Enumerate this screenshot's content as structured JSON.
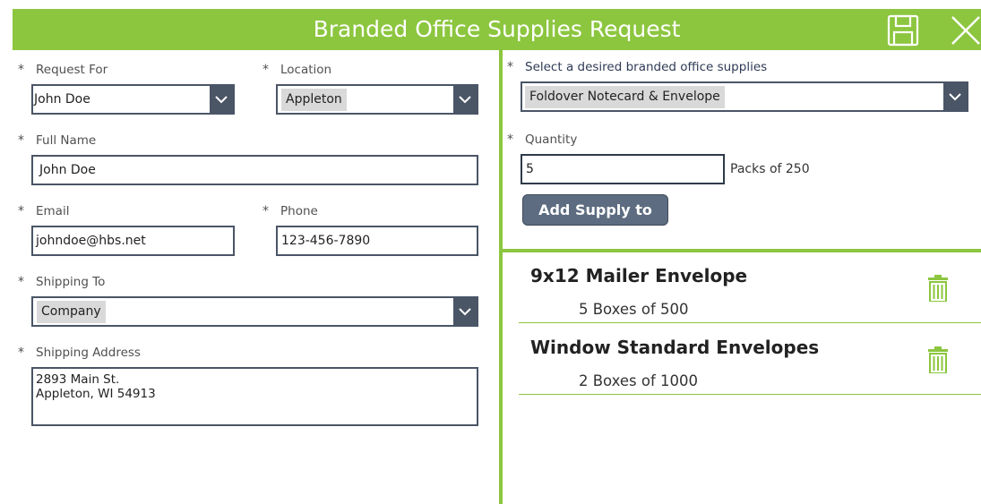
{
  "header": {
    "title": "Branded Office Supplies Request",
    "save_icon": "save-icon",
    "close_icon": "close-icon"
  },
  "form": {
    "request_for": {
      "label": "Request For",
      "value": "John Doe"
    },
    "location": {
      "label": "Location",
      "value": "Appleton"
    },
    "full_name": {
      "label": "Full Name",
      "value": "John Doe"
    },
    "email": {
      "label": "Email",
      "value": "johndoe@hbs.net"
    },
    "phone": {
      "label": "Phone",
      "value": "123-456-7890"
    },
    "shipping_to": {
      "label": "Shipping To",
      "value": "Company"
    },
    "shipping_address": {
      "label": "Shipping Address",
      "line1": "2893 Main St.",
      "line2": "Appleton, WI 54913"
    },
    "required_marker": "*"
  },
  "supply": {
    "select_label": "Select a desired branded office supplies",
    "selected": "Foldover Notecard & Envelope",
    "quantity_label": "Quantity",
    "quantity_value": "5",
    "unit": "Packs of 250",
    "add_button": "Add Supply to List"
  },
  "list": [
    {
      "title": "9x12 Mailer Envelope",
      "detail": "5 Boxes of 500"
    },
    {
      "title": "Window Standard Envelopes",
      "detail": "2 Boxes of 1000"
    }
  ],
  "colors": {
    "accent": "#8cc63f",
    "control_border": "#4a5566",
    "button": "#5d6c80",
    "chip": "#d9d9d9"
  }
}
